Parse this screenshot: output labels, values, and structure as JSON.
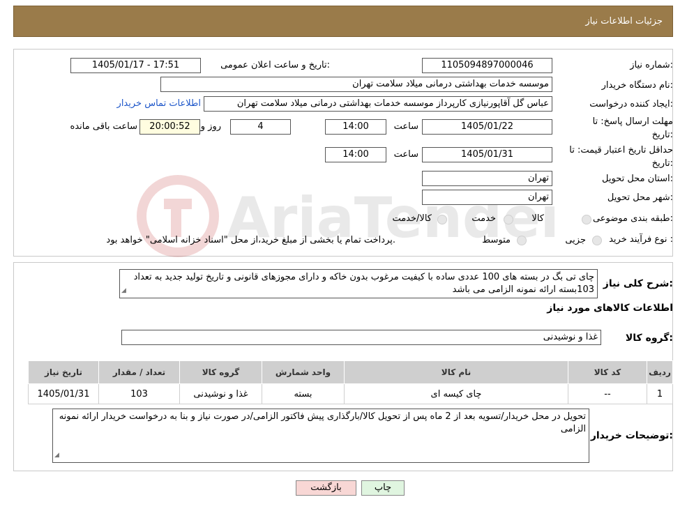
{
  "header": {
    "title": "جزئیات اطلاعات نیاز"
  },
  "fields": {
    "need_number_label": "شماره نیاز:",
    "need_number": "1105094897000046",
    "announce_label": "تاریخ و ساعت اعلان عمومی:",
    "announce_value": "1405/01/17 - 17:51",
    "buyer_org_label": "نام دستگاه خریدار:",
    "buyer_org": "موسسه خدمات بهداشتی درمانی میلاد سلامت تهران",
    "creator_label": "ایجاد کننده درخواست:",
    "creator": "عباس گل آقاپورنیازی کارپرداز موسسه خدمات بهداشتی درمانی میلاد سلامت تهران",
    "contact_link": "اطلاعات تماس خریدار",
    "deadline_label": "مهلت ارسال پاسخ: تا تاریخ:",
    "deadline_date": "1405/01/22",
    "time_label": "ساعت",
    "deadline_time": "14:00",
    "days_value": "4",
    "days_label": "روز و",
    "remaining_time": "20:00:52",
    "remaining_label": "ساعت باقی مانده",
    "validity_label": "حداقل تاریخ اعتبار قیمت: تا تاریخ:",
    "validity_date": "1405/01/31",
    "validity_time": "14:00",
    "province_label": "استان محل تحویل:",
    "province": "تهران",
    "city_label": "شهر محل تحویل:",
    "city": "تهران",
    "category_label": "طبقه بندی موضوعی:",
    "category_options": [
      "کالا",
      "خدمت",
      "کالا/خدمت"
    ],
    "process_label": "نوع فرآیند خرید :",
    "process_options": [
      "جزیی",
      "متوسط"
    ],
    "process_note": "پرداخت تمام یا بخشی از مبلغ خرید،از محل \"اسناد خزانه اسلامی\" خواهد بود."
  },
  "description": {
    "label": "شرح کلی نیاز:",
    "text": "چای تی بگ در بسته های 100 عددی ساده با کیفیت مرغوب بدون خاکه و دارای مجوزهای قانونی و تاریخ تولید جدید به تعداد 103بسته ارائه نمونه الزامی می باشد"
  },
  "goods_info_title": "اطلاعات کالاهای مورد نیاز",
  "goods_group": {
    "label": "گروه کالا:",
    "value": "غذا و نوشیدنی"
  },
  "table": {
    "headers": [
      "ردیف",
      "کد کالا",
      "نام کالا",
      "واحد شمارش",
      "گروه کالا",
      "تعداد / مقدار",
      "تاریخ نیاز"
    ],
    "rows": [
      [
        "1",
        "--",
        "چای کیسه ای",
        "بسته",
        "غذا و نوشیدنی",
        "103",
        "1405/01/31"
      ]
    ]
  },
  "buyer_notes": {
    "label": "توضیحات خریدار:",
    "text": "تحویل در محل خریدار/تسویه بعد از 2 ماه پس از تحویل کالا/بارگذاری پیش فاکتور الزامی/در صورت نیاز و بنا به درخواست خریدار ارائه نمونه الزامی"
  },
  "buttons": {
    "print": "چاپ",
    "back": "بازگشت"
  },
  "watermark": "AriaTender.neT",
  "colors": {
    "header_bg": "#9a7b4a",
    "link": "#1d56c9",
    "back_btn": "#f8d7d5",
    "print_btn": "#e0f5e0"
  }
}
